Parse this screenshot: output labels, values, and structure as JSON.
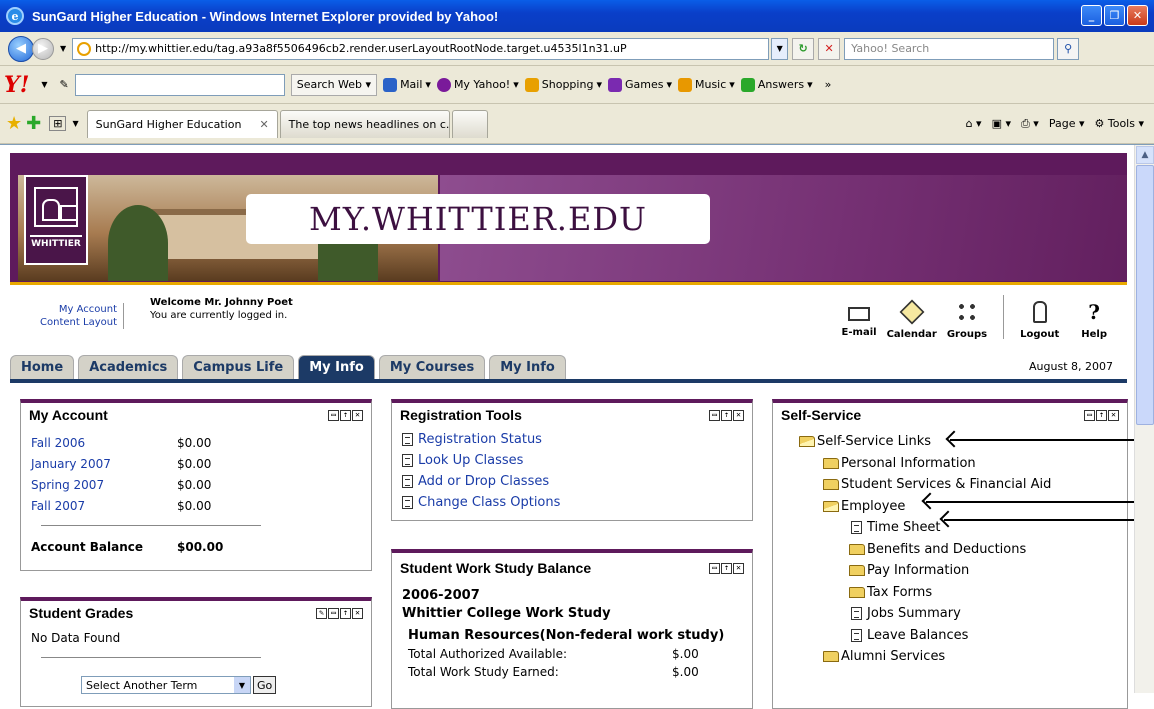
{
  "window": {
    "title": "SunGard Higher Education - Windows Internet Explorer provided by Yahoo!"
  },
  "address": {
    "url": "http://my.whittier.edu/tag.a93a8f5506496cb2.render.userLayoutRootNode.target.u4535l1n31.uP",
    "search_placeholder": "Yahoo! Search"
  },
  "yahoo_toolbar": {
    "search_web": "Search Web",
    "links": [
      {
        "label": "Mail",
        "icon": "mail-icon",
        "color": "#2a62c8"
      },
      {
        "label": "My Yahoo!",
        "icon": "my-yahoo-icon",
        "color": "#7a1a9a"
      },
      {
        "label": "Shopping",
        "icon": "shopping-icon",
        "color": "#e8a000"
      },
      {
        "label": "Games",
        "icon": "games-icon",
        "color": "#7a2ab0"
      },
      {
        "label": "Music",
        "icon": "music-icon",
        "color": "#e89800"
      },
      {
        "label": "Answers",
        "icon": "answers-icon",
        "color": "#2aa82a"
      }
    ]
  },
  "browser_tabs": [
    {
      "label": "SunGard Higher Education"
    },
    {
      "label": "The top news headlines on c..."
    }
  ],
  "command_bar": {
    "page": "Page",
    "tools": "Tools"
  },
  "banner": {
    "title": "MY.WHITTIER.EDU",
    "logo_text": "WHITTIER"
  },
  "account_bar": {
    "my_account": "My Account",
    "content_layout": "Content Layout",
    "welcome": "Welcome Mr. Johnny Poet",
    "logged_in": "You are currently logged in.",
    "tools": [
      {
        "label": "E-mail",
        "icon": "email-icon"
      },
      {
        "label": "Calendar",
        "icon": "calendar-icon"
      },
      {
        "label": "Groups",
        "icon": "groups-icon"
      },
      {
        "label": "Logout",
        "icon": "logout-icon"
      },
      {
        "label": "Help",
        "icon": "help-icon"
      }
    ]
  },
  "tabs": [
    "Home",
    "Academics",
    "Campus Life",
    "My Info",
    "My Courses",
    "My Info"
  ],
  "active_tab": "My Info",
  "date": "August 8, 2007",
  "my_account": {
    "title": "My Account",
    "rows": [
      {
        "term": "Fall 2006",
        "amount": "$0.00"
      },
      {
        "term": "January 2007",
        "amount": "$0.00"
      },
      {
        "term": "Spring 2007",
        "amount": "$0.00"
      },
      {
        "term": "Fall 2007",
        "amount": "$0.00"
      }
    ],
    "balance_label": "Account Balance",
    "balance_value": "$00.00"
  },
  "student_grades": {
    "title": "Student Grades",
    "no_data": "No Data Found",
    "select_label": "Select Another Term",
    "go": "Go"
  },
  "registration_tools": {
    "title": "Registration Tools",
    "links": [
      "Registration Status",
      "Look Up Classes",
      "Add or Drop Classes",
      "Change Class Options"
    ]
  },
  "work_study": {
    "title": "Student Work Study Balance",
    "year": "2006-2007",
    "program": "Whittier College Work Study",
    "section": "Human Resources(Non-federal work study)",
    "rows": [
      {
        "label": "Total Authorized Available:",
        "value": "$.00"
      },
      {
        "label": "Total Work Study Earned:",
        "value": "$.00"
      }
    ]
  },
  "self_service": {
    "title": "Self-Service",
    "items": [
      {
        "label": "Self-Service Links",
        "level": 0,
        "type": "folder-open"
      },
      {
        "label": "Personal Information",
        "level": 1,
        "type": "folder"
      },
      {
        "label": "Student Services & Financial Aid",
        "level": 1,
        "type": "folder"
      },
      {
        "label": "Employee",
        "level": 1,
        "type": "folder-open"
      },
      {
        "label": "Time Sheet",
        "level": 2,
        "type": "doc"
      },
      {
        "label": "Benefits and Deductions",
        "level": 2,
        "type": "folder"
      },
      {
        "label": "Pay Information",
        "level": 2,
        "type": "folder"
      },
      {
        "label": "Tax Forms",
        "level": 2,
        "type": "folder"
      },
      {
        "label": "Jobs Summary",
        "level": 2,
        "type": "doc"
      },
      {
        "label": "Leave Balances",
        "level": 2,
        "type": "doc"
      },
      {
        "label": "Alumni Services",
        "level": 1,
        "type": "folder"
      }
    ]
  }
}
